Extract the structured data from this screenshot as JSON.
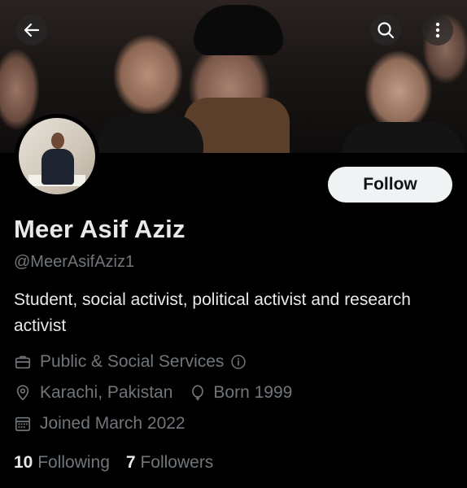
{
  "profile": {
    "name": "Meer Asif Aziz",
    "handle": "@MeerAsifAziz1",
    "bio": "Student, social activist, political activist and research activist",
    "category": "Public & Social Services",
    "location": "Karachi, Pakistan",
    "birth": "Born 1999",
    "joined": "Joined March 2022"
  },
  "actions": {
    "follow_label": "Follow"
  },
  "stats": {
    "following_count": "10",
    "following_label": "Following",
    "followers_count": "7",
    "followers_label": "Followers"
  },
  "icons": {
    "back": "arrow-left-icon",
    "search": "search-icon",
    "more": "more-vertical-icon",
    "category": "briefcase-icon",
    "info": "info-icon",
    "location": "location-pin-icon",
    "birth": "balloon-icon",
    "joined": "calendar-icon"
  },
  "colors": {
    "background": "#000000",
    "text": "#e7e9ea",
    "muted": "#71767b",
    "button_bg": "#eff3f4",
    "button_text": "#0f1419"
  }
}
